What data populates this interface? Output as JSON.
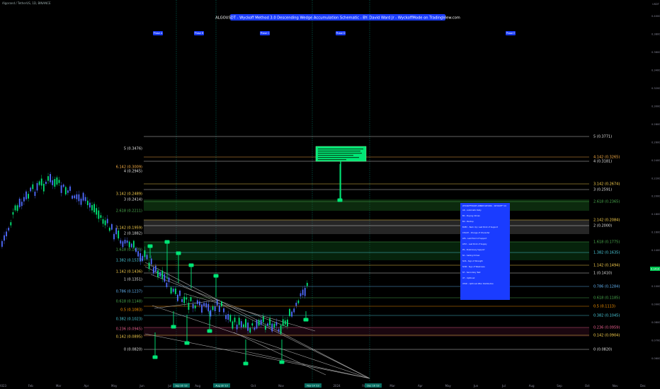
{
  "symbol_line": "Algorand / TetherUS, 1D, BINANCE",
  "title": "ALGOUSDT - Wyckoff Method 3.0 Descending Wedge Accumulation Schematic - BY: David Ward Jr - WyckoffMode on TradingView.com",
  "currency": "USDT",
  "current_price": "0.1410",
  "phases": [
    "Phase A",
    "Phase B",
    "Phase C",
    "Phase D",
    "Phase E"
  ],
  "time_flags": [
    "Sep 16 '23",
    "Aug 28 '23",
    "Nov 14 '23",
    "Dec 16 '23"
  ],
  "months": [
    "2023",
    "Feb",
    "Mar",
    "Apr",
    "May",
    "Jun",
    "Jul",
    "Aug",
    "Sep",
    "Oct",
    "Nov",
    "Dec",
    "2024",
    "Feb",
    "Mar",
    "Apr",
    "May",
    "Jun",
    "Jul",
    "Aug",
    "Sep",
    "Oct",
    "Nov",
    "Dec"
  ],
  "price_ticks": [
    "0.4000",
    "0.3800",
    "0.3600",
    "0.3400",
    "0.3200",
    "0.3000",
    "0.2800",
    "0.2600",
    "0.2400",
    "0.2200",
    "0.2000",
    "0.1800",
    "0.1600",
    "0.1400",
    "0.1200",
    "0.1000",
    "0.0900",
    "0.0800",
    "0.0700",
    "0.0600"
  ],
  "left_fib": [
    {
      "label": "5 (0.3476)",
      "color": "#e0e0e0"
    },
    {
      "label": "6.142 (0.3009)",
      "color": "#ffb347"
    },
    {
      "label": "4 (0.2945)",
      "color": "#e0e0e0"
    },
    {
      "label": "3.142 (0.2489)",
      "color": "#ffd54f"
    },
    {
      "label": "3 (0.2414)",
      "color": "#e0e0e0"
    },
    {
      "label": "2.618 (0.2211)",
      "color": "#4caf50"
    },
    {
      "label": "2.142 (0.1959)",
      "color": "#ffd54f"
    },
    {
      "label": "2 (0.1882)",
      "color": "#e0e0e0"
    },
    {
      "label": "1.618 (0.1679)",
      "color": "#4caf50"
    },
    {
      "label": "1.382 (0.1531)",
      "color": "#4dd0e1"
    },
    {
      "label": "1.142 (0.1436)",
      "color": "#ffd54f"
    },
    {
      "label": "1 (0.1351)",
      "color": "#e0e0e0"
    },
    {
      "label": "0.786 (0.1237)",
      "color": "#64b5f6"
    },
    {
      "label": "0.618 (0.1148)",
      "color": "#4caf50"
    },
    {
      "label": "0.5 (0.1083)",
      "color": "#ff9800"
    },
    {
      "label": "0.382 (0.1023)",
      "color": "#4dd0e1"
    },
    {
      "label": "0.236 (0.0945)",
      "color": "#f06292"
    },
    {
      "label": "0.142 (0.0895)",
      "color": "#ffd54f"
    },
    {
      "label": "0 (0.0820)",
      "color": "#e0e0e0"
    }
  ],
  "right_fib": [
    {
      "label": "5 (0.3771)",
      "color": "#e0e0e0"
    },
    {
      "label": "4.142 (0.3265)",
      "color": "#ffb347"
    },
    {
      "label": "4 (0.3181)",
      "color": "#e0e0e0"
    },
    {
      "label": "3.142 (0.2674)",
      "color": "#ffd54f"
    },
    {
      "label": "3 (0.2591)",
      "color": "#e0e0e0"
    },
    {
      "label": "2.618 (0.2365)",
      "color": "#4caf50"
    },
    {
      "label": "2.142 (0.2084)",
      "color": "#ffd54f"
    },
    {
      "label": "2 (0.2000)",
      "color": "#e0e0e0"
    },
    {
      "label": "1.618 (0.1775)",
      "color": "#4caf50"
    },
    {
      "label": "1.382 (0.1635)",
      "color": "#4dd0e1"
    },
    {
      "label": "1.142 (0.1494)",
      "color": "#ffd54f"
    },
    {
      "label": "1 (0.1410)",
      "color": "#e0e0e0"
    },
    {
      "label": "0.786 (0.1284)",
      "color": "#64b5f6"
    },
    {
      "label": "0.618 (0.1185)",
      "color": "#4caf50"
    },
    {
      "label": "0.5 (0.1113)",
      "color": "#ff9800"
    },
    {
      "label": "0.382 (0.1045)",
      "color": "#4dd0e1"
    },
    {
      "label": "0.236 (0.0959)",
      "color": "#f06292"
    },
    {
      "label": "0.142 (0.0904)",
      "color": "#ffd54f"
    },
    {
      "label": "0 (0.0820)",
      "color": "#e0e0e0"
    }
  ],
  "legend_title": "WYCKOFFMODE ABBREVIATIONS - WYCKOFF 3.0",
  "legend_lines": [
    "AR - Automatic Rally",
    "BC - Buying Climax",
    "BU - Backup",
    "BUEC - Back Up / Last Point of Support",
    "CHoCH - Change of Character",
    "LPS - Last Point of Support",
    "LPSY - Last Point of Supply",
    "PS - Preliminary Support",
    "SC - Selling Climax",
    "SOS - Sign of Strength",
    "SOW - Sign of Weakness",
    "ST - Secondary Test",
    "UT - Upthrust",
    "UTAD - Upthrust After Distribution"
  ],
  "chart_data": {
    "type": "candlestick",
    "title": "ALGOUSDT - Wyckoff Method 3.0 Descending Wedge Accumulation Schematic - BY: David Ward Jr - WyckoffMode on TradingView.com",
    "y_scale": "log",
    "ylim": [
      0.055,
      0.42
    ],
    "current_price": 0.141,
    "series_close_shape": [
      0.19,
      0.2,
      0.22,
      0.23,
      0.24,
      0.26,
      0.28,
      0.29,
      0.27,
      0.28,
      0.26,
      0.25,
      0.24,
      0.23,
      0.21,
      0.2,
      0.19,
      0.18,
      0.17,
      0.165,
      0.16,
      0.15,
      0.14,
      0.13,
      0.125,
      0.12,
      0.115,
      0.11,
      0.115,
      0.12,
      0.118,
      0.112,
      0.108,
      0.104,
      0.1,
      0.098,
      0.1,
      0.103,
      0.105,
      0.1,
      0.097,
      0.095,
      0.094,
      0.096,
      0.1,
      0.105,
      0.11,
      0.12,
      0.13,
      0.135,
      0.141
    ],
    "series_name": "ALGOUSDT"
  }
}
